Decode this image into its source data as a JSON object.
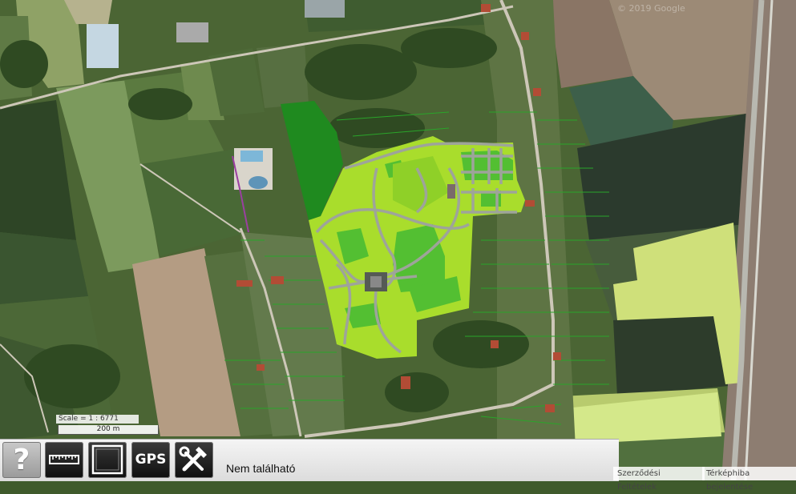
{
  "map": {
    "scale_text": "Scale = 1 : 6771",
    "scale_bar_label": "200 m",
    "watermark": "© 2019 Google",
    "watermark_year": "2019"
  },
  "toolbar": {
    "help_label": "?",
    "measure_label": "",
    "layers_label": "",
    "gps_label": "GPS",
    "tools_label": "",
    "status": "Nem található"
  },
  "attribution": {
    "terms": "Szerződési Feltételek",
    "report": "Térképhiba bejelentése"
  }
}
